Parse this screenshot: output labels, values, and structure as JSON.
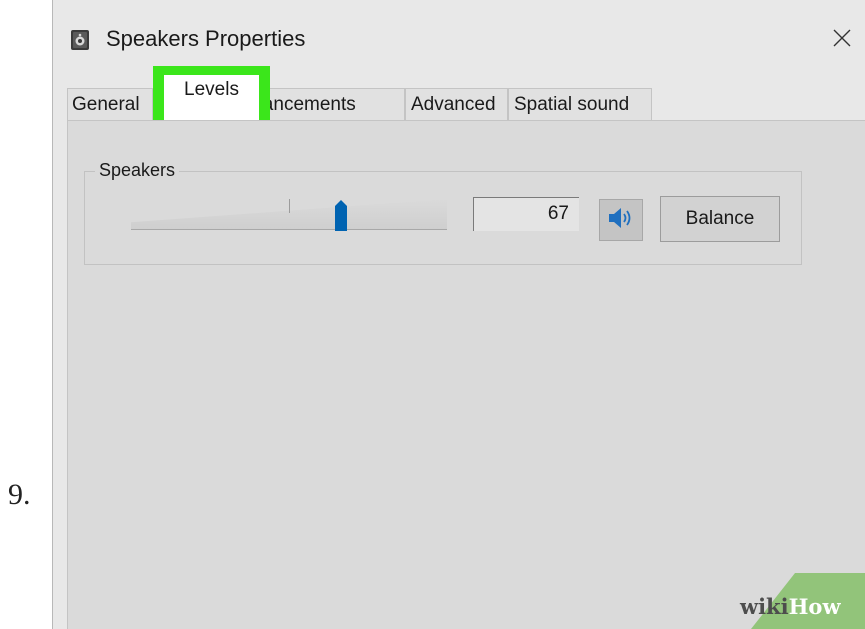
{
  "step": {
    "number": "9."
  },
  "window": {
    "title": "Speakers Properties",
    "icon": "speaker-box-icon",
    "close_icon": "close-icon"
  },
  "tabs": [
    {
      "label": "General"
    },
    {
      "label": "Levels",
      "selected": true,
      "highlight_color": "#3be61b"
    },
    {
      "label": "Enhancements"
    },
    {
      "label": "Advanced"
    },
    {
      "label": "Spatial sound"
    }
  ],
  "levels": {
    "group_label": "Speakers",
    "volume_value": "67",
    "volume_level": 67,
    "volume_max": 100,
    "thumb_color": "#0063b1",
    "mute_icon": "speaker-volume-icon",
    "balance_label": "Balance"
  },
  "watermark": {
    "wiki": "wiki",
    "how": "How"
  }
}
